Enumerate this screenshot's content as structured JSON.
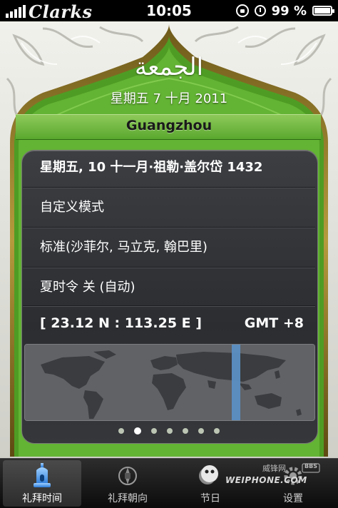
{
  "status_bar": {
    "carrier": "Clarks",
    "time": "10:05",
    "battery_percent": "99 %"
  },
  "header": {
    "hijri_glyph": "الجمعة",
    "gregorian_date": "星期五 7 十月 2011",
    "city": "Guangzhou"
  },
  "info": {
    "hijri_date": "星期五, 10 十一月·祖勒·盖尔岱 1432",
    "mode": "自定义模式",
    "calc_method": "标准(沙菲尔, 马立克, 翰巴里)",
    "dst": "夏时令  关 (自动)",
    "coordinates": "[ 23.12 N : 113.25 E ]",
    "gmt": "GMT +8"
  },
  "map": {
    "timezone_highlight_color": "#5b8fc4",
    "land_color": "#3a3c3f",
    "sea_color": "#606266"
  },
  "pager": {
    "total": 7,
    "active_index": 1
  },
  "tabbar": {
    "tabs": [
      {
        "label": "礼拜时间",
        "icon": "mosque-lamp-icon",
        "active": true
      },
      {
        "label": "礼拜朝向",
        "icon": "compass-icon",
        "active": false
      },
      {
        "label": "节日",
        "icon": "calendar-icon",
        "active": false
      },
      {
        "label": "设置",
        "icon": "gear-icon",
        "active": false
      }
    ]
  },
  "watermark": {
    "brand": "WEIPHONE.COM",
    "cn": "威锋网",
    "badge": "BBS"
  },
  "colors": {
    "accent_green": "#5aa82e",
    "card_dark": "#2f3135",
    "frame_stone": "#e7e7e2"
  }
}
